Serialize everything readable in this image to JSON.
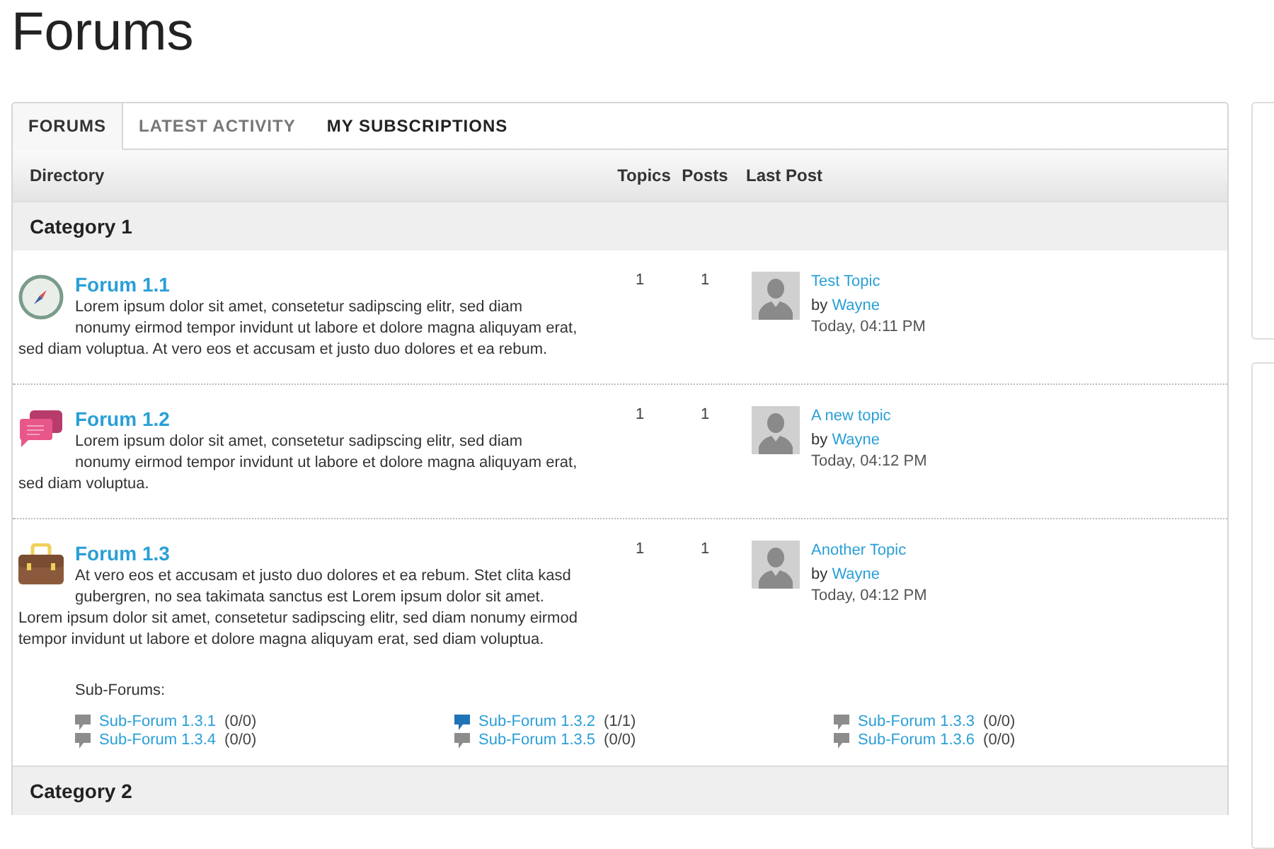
{
  "page_title": "Forums",
  "tabs": [
    {
      "label": "FORUMS",
      "selected": true
    },
    {
      "label": "LATEST ACTIVITY",
      "selected": false
    },
    {
      "label": "MY SUBSCRIPTIONS",
      "selected": false
    }
  ],
  "columns": [
    "Directory",
    "Topics",
    "Posts",
    "Last Post"
  ],
  "categories": [
    {
      "title": "Category 1",
      "forums": [
        {
          "kind": "compass",
          "title": "Forum 1.1",
          "description": "Lorem ipsum dolor sit amet, consetetur sadipscing elitr, sed diam nonumy eirmod tempor invidunt ut labore et dolore magna aliquyam erat, sed diam voluptua. At vero eos et accusam et justo duo dolores et ea rebum.",
          "topics": "1",
          "posts": "1",
          "last_post": {
            "title": "Test Topic",
            "by": "by",
            "author": "Wayne",
            "time": "Today, 04:11 PM"
          }
        },
        {
          "kind": "chat",
          "title": "Forum 1.2",
          "description": "Lorem ipsum dolor sit amet, consetetur sadipscing elitr, sed diam nonumy eirmod tempor invidunt ut labore et dolore magna aliquyam erat, sed diam voluptua.",
          "topics": "1",
          "posts": "1",
          "last_post": {
            "title": "A new topic",
            "by": "by",
            "author": "Wayne",
            "time": "Today, 04:12 PM"
          }
        },
        {
          "kind": "briefcase",
          "title": "Forum 1.3",
          "description": "At vero eos et accusam et justo duo dolores et ea rebum. Stet clita kasd gubergren, no sea takimata sanctus est Lorem ipsum dolor sit amet. Lorem ipsum dolor sit amet, consetetur sadipscing elitr, sed diam nonumy eirmod tempor invidunt ut labore et dolore magna aliquyam erat, sed diam voluptua.",
          "topics": "1",
          "posts": "1",
          "last_post": {
            "title": "Another Topic",
            "by": "by",
            "author": "Wayne",
            "time": "Today, 04:12 PM"
          },
          "subforums_label": "Sub-Forums:",
          "subforums": [
            {
              "name": "Sub-Forum 1.3.1",
              "counts": "(0/0)",
              "unread": false
            },
            {
              "name": "Sub-Forum 1.3.2",
              "counts": "(1/1)",
              "unread": true
            },
            {
              "name": "Sub-Forum 1.3.3",
              "counts": "(0/0)",
              "unread": false
            },
            {
              "name": "Sub-Forum 1.3.4",
              "counts": "(0/0)",
              "unread": false
            },
            {
              "name": "Sub-Forum 1.3.5",
              "counts": "(0/0)",
              "unread": false
            },
            {
              "name": "Sub-Forum 1.3.6",
              "counts": "(0/0)",
              "unread": false
            }
          ]
        }
      ]
    },
    {
      "title": "Category 2"
    }
  ]
}
